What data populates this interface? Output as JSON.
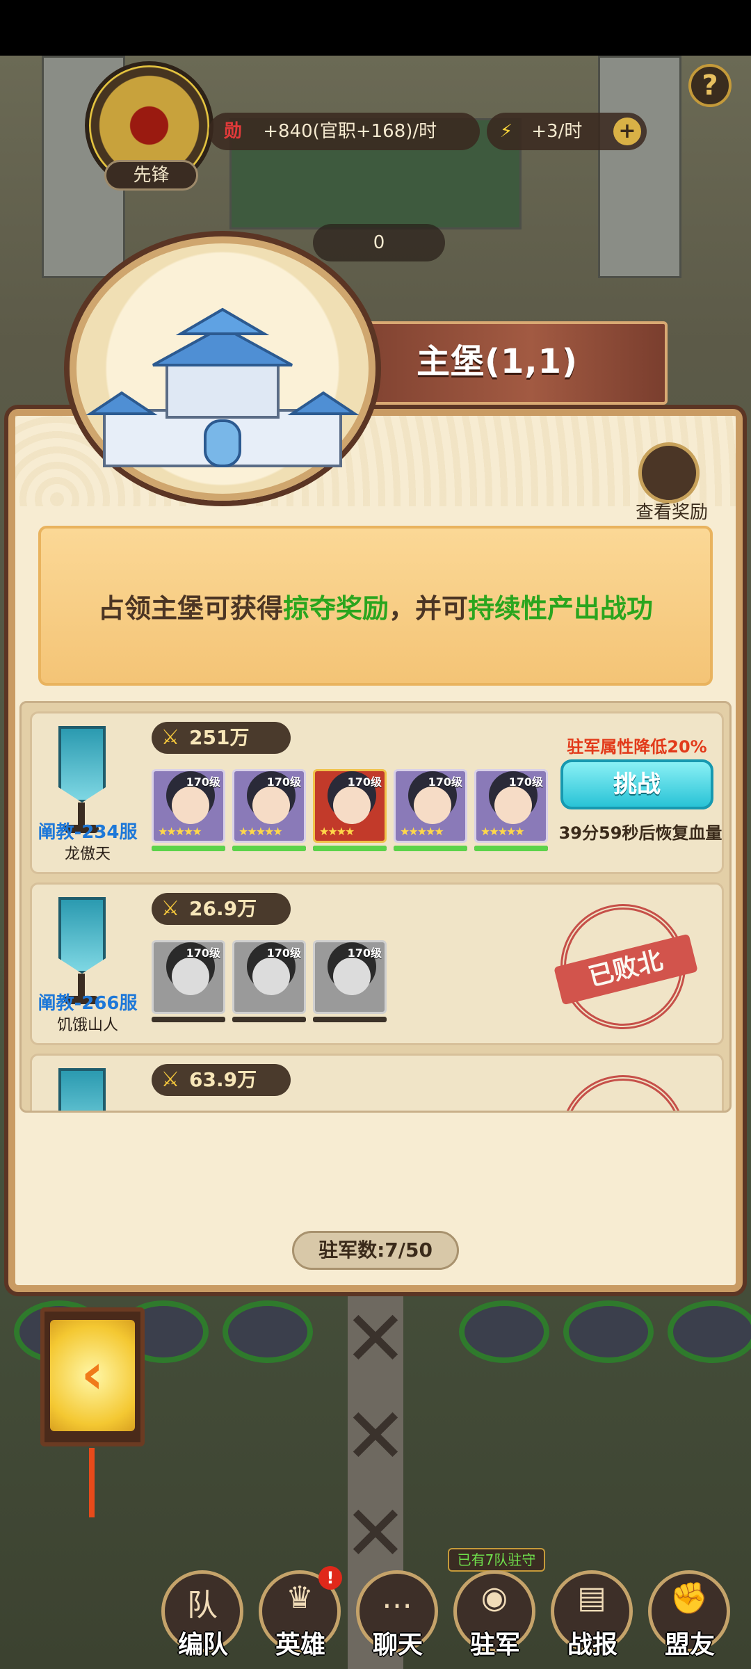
{
  "hud": {
    "rank_label": "先锋",
    "merit_rate": "+840(官职+168)/时",
    "energy_rate": "+3/时",
    "plus_icon": "plus-icon",
    "help_icon": "?",
    "counter_value": "0"
  },
  "castle": {
    "title": "主堡(1,1)",
    "view_reward_label": "查看奖励",
    "info": {
      "part1": "占领主堡可获得",
      "hl1": "掠夺奖励",
      "part2": "，并可",
      "hl2": "持续性产出战功"
    }
  },
  "garrisons": [
    {
      "server": "阐教-234服",
      "player": "龙傲天",
      "power": "251万",
      "debuff": "驻军属性降低20%",
      "challenge_label": "挑战",
      "recover_text": "39分59秒后恢复血量",
      "heroes": [
        {
          "level": "170级",
          "stars": "★★★★★",
          "hp": 1.0
        },
        {
          "level": "170级",
          "stars": "★★★★★",
          "hp": 1.0
        },
        {
          "level": "170级",
          "stars": "★★★★",
          "hp": 1.0
        },
        {
          "level": "170级",
          "stars": "★★★★★",
          "hp": 1.0
        },
        {
          "level": "170级",
          "stars": "★★★★★",
          "hp": 1.0
        }
      ]
    },
    {
      "server": "阐教-266服",
      "player": "饥饿山人",
      "power": "26.9万",
      "defeat_stamp": "已败北",
      "heroes": [
        {
          "level": "170级",
          "hp": 0
        },
        {
          "level": "170级",
          "hp": 0
        },
        {
          "level": "170级",
          "hp": 0
        }
      ]
    },
    {
      "power": "63.9万"
    }
  ],
  "garrison_count": "驻军数:7/50",
  "nav": {
    "items": [
      {
        "label": "编队",
        "icon": "team-icon",
        "glyph": "队"
      },
      {
        "label": "英雄",
        "icon": "hero-icon",
        "glyph": "♛"
      },
      {
        "label": "聊天",
        "icon": "chat-icon",
        "glyph": "…"
      },
      {
        "label": "驻军",
        "icon": "garrison-icon",
        "glyph": "◉"
      },
      {
        "label": "战报",
        "icon": "report-icon",
        "glyph": "▤"
      },
      {
        "label": "盟友",
        "icon": "ally-icon",
        "glyph": "✊"
      }
    ],
    "garrison_note": "已有7队驻守",
    "hero_alert": "!"
  },
  "colors": {
    "highlight_green": "#2aa51e",
    "debuff_red": "#e23a1a",
    "server_blue": "#1e78d8",
    "challenge_cyan": "#29c3d6"
  }
}
